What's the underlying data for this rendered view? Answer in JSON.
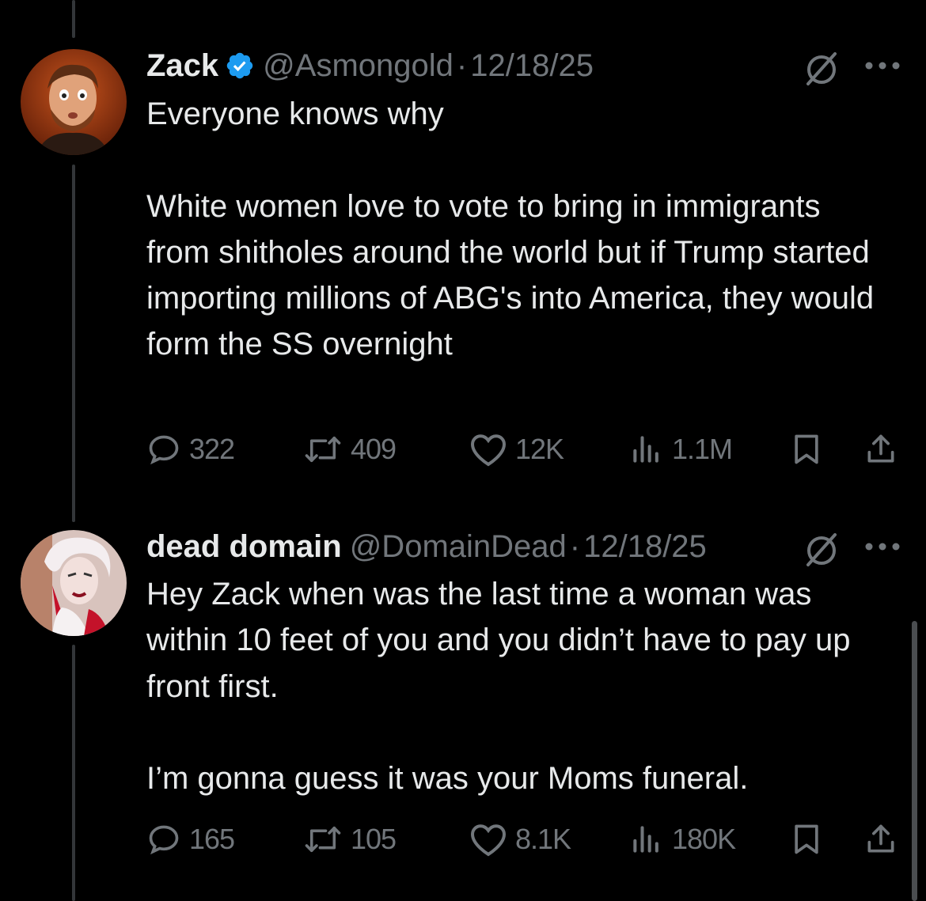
{
  "tweets": [
    {
      "name": "Zack",
      "handle": "@Asmongold",
      "separator": "·",
      "date": "12/18/25",
      "verified": true,
      "text": "Everyone knows why\n\nWhite women love to vote to bring in immigrants from shitholes around the world but if Trump started importing millions of ABG's into America, they would form the SS overnight",
      "stats": {
        "replies": "322",
        "reposts": "409",
        "likes": "12K",
        "views": "1.1M"
      }
    },
    {
      "name": "dead domain",
      "handle": "@DomainDead",
      "separator": "·",
      "date": "12/18/25",
      "verified": false,
      "text": "Hey Zack when was the last time a woman was within 10 feet of you and you didn’t have to pay up front first.\n\nI’m gonna guess it was your Moms funeral.",
      "stats": {
        "replies": "165",
        "reposts": "105",
        "likes": "8.1K",
        "views": "180K"
      }
    }
  ],
  "colors": {
    "background": "#000000",
    "text": "#e7e9ea",
    "muted": "#71767b",
    "verified": "#1d9bf0"
  },
  "icons": [
    "verified-badge-icon",
    "grok-icon",
    "more-icon",
    "reply-icon",
    "repost-icon",
    "like-icon",
    "views-icon",
    "bookmark-icon",
    "share-icon"
  ]
}
